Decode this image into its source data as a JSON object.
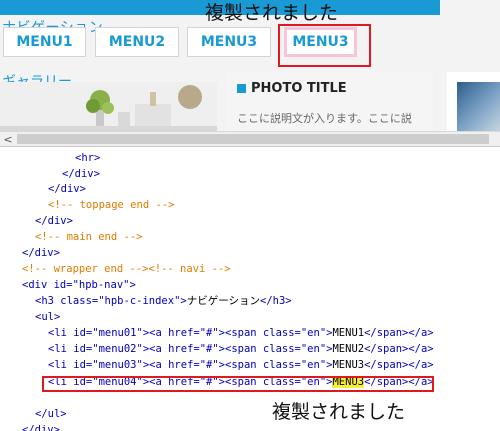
{
  "annotation_text": "複製されました",
  "preview": {
    "nav_heading": "ナビゲーション",
    "menus": [
      "MENU1",
      "MENU2",
      "MENU3",
      "MENU3"
    ],
    "gallery_heading": "ギャラリー",
    "photo_title": "PHOTO TITLE",
    "photo_desc": "ここに説明文が入ります。ここに説"
  },
  "scrollbar": {
    "left_arrow": "<"
  },
  "code": {
    "line1": "<hr>",
    "line2": "</div>",
    "line3": "</div>",
    "line4": "<!-- toppage end -->",
    "line5": "</div>",
    "line6": "<!-- main end -->",
    "line7": "</div>",
    "line8": "<!-- wrapper end --><!-- navi -->",
    "line9": "<div id=\"hpb-nav\">",
    "line10_a": "<h3 class=\"hpb-c-index\">",
    "line10_b": "ナビゲーション",
    "line10_c": "</h3>",
    "line11": "<ul>",
    "li": [
      {
        "open": "<li id=\"menu01\"><a href=\"#\"><span class=\"en\">",
        "text": "MENU1",
        "close": "</span></a>"
      },
      {
        "open": "<li id=\"menu02\"><a href=\"#\"><span class=\"en\">",
        "text": "MENU2",
        "close": "</span></a>"
      },
      {
        "open": "<li id=\"menu03\"><a href=\"#\"><span class=\"en\">",
        "text": "MENU3",
        "close": "</span></a>"
      },
      {
        "open": "<li id=\"menu04\"><a href=\"#\"><span class=\"en\">",
        "text": "MENU3",
        "close": "</span></a>"
      }
    ],
    "line16": "</ul>",
    "line17": "</div>"
  },
  "colors": {
    "accent": "#1a9ad4",
    "highlight_box": "#e0191e",
    "tag": "#0000c0",
    "comment": "#e07b00",
    "selection": "#f5ef3a"
  }
}
